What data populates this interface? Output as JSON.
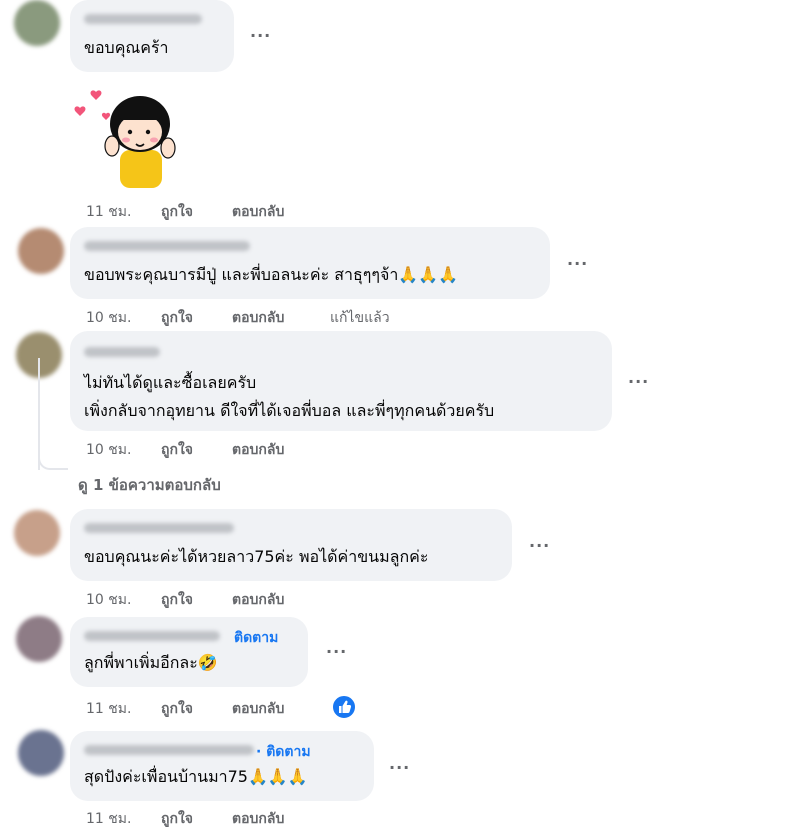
{
  "comments": [
    {
      "text": "ขอบคุณคร้า",
      "time": "11 ชม.",
      "like": "ถูกใจ",
      "reply": "ตอบกลับ"
    },
    {
      "text": "ขอบพระคุณบารมีปู่ และพี่บอลนะค่ะ สาธุๆๆจ้า🙏🙏🙏",
      "time": "10 ชม.",
      "like": "ถูกใจ",
      "reply": "ตอบกลับ",
      "edited": "แก้ไขแล้ว"
    },
    {
      "line1": "ไม่ทันได้ดูและซื้อเลยครับ",
      "line2": "เพิ่งกลับจากอุทยาน ดีใจที่ได้เจอพี่บอล และพี่ๆทุกคนด้วยครับ",
      "time": "10 ชม.",
      "like": "ถูกใจ",
      "reply": "ตอบกลับ"
    },
    {
      "text": "ขอบคุณนะค่ะได้หวยลาว75ค่ะ พอได้ค่าขนมลูกค่ะ",
      "time": "10 ชม.",
      "like": "ถูกใจ",
      "reply": "ตอบกลับ"
    },
    {
      "follow": "ติดตาม",
      "text": "ลูกพี่พาเพิ่มอีกละ🤣",
      "time": "11 ชม.",
      "like": "ถูกใจ",
      "reply": "ตอบกลับ"
    },
    {
      "follow": "· ติดตาม",
      "text": "สุดปังค่ะเพื่อนบ้านมา75🙏🙏🙏",
      "time": "11 ชม.",
      "like": "ถูกใจ",
      "reply": "ตอบกลับ"
    }
  ],
  "view_replies": "ดู 1 ข้อความตอบกลับ",
  "more_label": "···",
  "colors": {
    "bubble": "#f0f2f5",
    "meta": "#65676b",
    "link": "#1877f2",
    "text": "#050505"
  },
  "icons": {
    "more": "more-icon",
    "like_reaction": "thumbs-up-icon",
    "sticker": "girl-hearts-sticker"
  }
}
